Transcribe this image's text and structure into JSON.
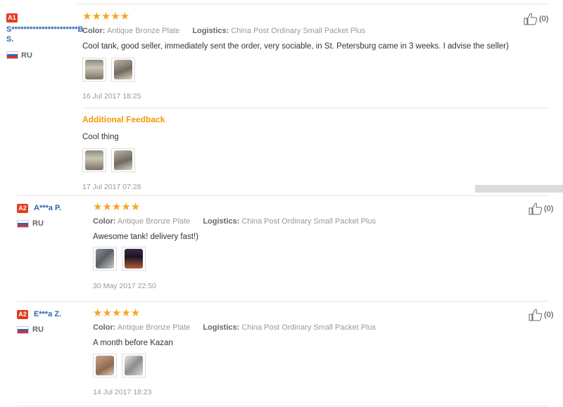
{
  "reviews": [
    {
      "badge": "A1",
      "name": "S**********************B S.",
      "name_line1": "S**********************B",
      "name_line2": "S.",
      "country": "RU",
      "stars": "★★★★★",
      "color_label": "Color:",
      "color_value": "Antique Bronze Plate",
      "logistics_label": "Logistics:",
      "logistics_value": "China Post Ordinary Small Packet Plus",
      "text": "Cool tank, good seller, immediately sent the order, very sociable, in St. Petersburg came in 3 weeks. I advise the seller)",
      "date": "16 Jul 2017 18:25",
      "helpful_count": "(0)",
      "additional": {
        "title": "Additional Feedback",
        "text": "Cool thing",
        "date": "17 Jul 2017 07:28"
      }
    },
    {
      "badge": "A2",
      "name": "A***a P.",
      "country": "RU",
      "stars": "★★★★★",
      "color_label": "Color:",
      "color_value": "Antique Bronze Plate",
      "logistics_label": "Logistics:",
      "logistics_value": "China Post Ordinary Small Packet Plus",
      "text": "Awesome tank! delivery fast!)",
      "date": "30 May 2017 22:50",
      "helpful_count": "(0)"
    },
    {
      "badge": "A2",
      "name": "E***a Z.",
      "country": "RU",
      "stars": "★★★★★",
      "color_label": "Color:",
      "color_value": "Antique Bronze Plate",
      "logistics_label": "Logistics:",
      "logistics_value": "China Post Ordinary Small Packet Plus",
      "text": "A month before Kazan",
      "date": "14 Jul 2017 18:23",
      "helpful_count": "(0)"
    }
  ],
  "icons": {
    "like": "thumbs-up-icon",
    "flag": "russia-flag-icon",
    "star": "star-icon"
  },
  "colors": {
    "accent_orange": "#f39800",
    "star": "#f5a623",
    "badge_red": "#e33b1f",
    "name_blue": "#2d64b3"
  }
}
